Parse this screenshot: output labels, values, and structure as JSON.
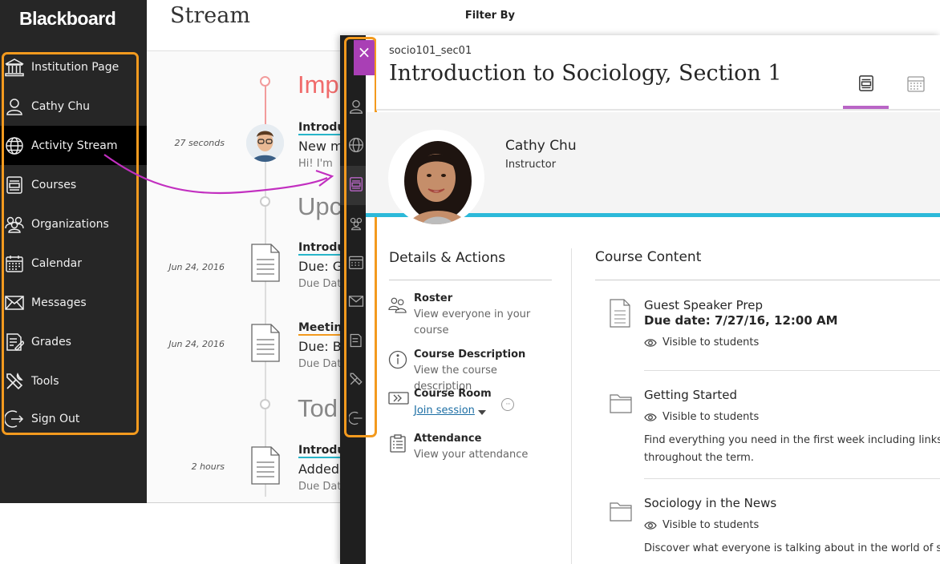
{
  "nav": {
    "brand": "Blackboard",
    "items": [
      {
        "label": "Institution Page",
        "icon": "institution-icon"
      },
      {
        "label": "Cathy Chu",
        "icon": "user-icon"
      },
      {
        "label": "Activity Stream",
        "icon": "globe-icon"
      },
      {
        "label": "Courses",
        "icon": "courses-icon"
      },
      {
        "label": "Organizations",
        "icon": "organizations-icon"
      },
      {
        "label": "Calendar",
        "icon": "calendar-icon"
      },
      {
        "label": "Messages",
        "icon": "messages-icon"
      },
      {
        "label": "Grades",
        "icon": "grades-icon"
      },
      {
        "label": "Tools",
        "icon": "tools-icon"
      },
      {
        "label": "Sign Out",
        "icon": "sign-out-icon"
      }
    ]
  },
  "stream": {
    "title": "Stream",
    "filter_label": "Filter By",
    "sections": [
      "Imp",
      "Upc",
      "Tod"
    ],
    "items": [
      {
        "time": "27 seconds",
        "title": "Introdu",
        "main": "New m",
        "sub": "Hi! I'm"
      },
      {
        "time": "Jun 24, 2016",
        "title": "Introdu",
        "main": "Due: Gu",
        "sub": "Due Dat"
      },
      {
        "time": "Jun 24, 2016",
        "title": "Meeting",
        "main": "Due: Br",
        "sub": "Due Dat"
      },
      {
        "time": "2 hours",
        "title": "Introdu",
        "main": "Added:",
        "sub": "Due Dat"
      }
    ]
  },
  "course": {
    "close_label": "×",
    "course_id": "socio101_sec01",
    "title": "Introduction to Sociology, Section 1",
    "instructor": {
      "name": "Cathy Chu",
      "role": "Instructor"
    },
    "details": {
      "title": "Details & Actions",
      "roster": {
        "title": "Roster",
        "sub": "View everyone in your course"
      },
      "description": {
        "title": "Course Description",
        "sub": "View the course description"
      },
      "room": {
        "title": "Course Room",
        "link": "Join session",
        "more": "···"
      },
      "attendance": {
        "title": "Attendance",
        "sub": "View your attendance"
      }
    },
    "content": {
      "title": "Course Content",
      "items": [
        {
          "title": "Guest Speaker Prep",
          "due": "Due date: 7/27/16, 12:00 AM",
          "visibility": "Visible to students",
          "desc": ""
        },
        {
          "title": "Getting Started",
          "due": "",
          "visibility": "Visible to students",
          "desc1": "Find everything you need in the first week including links to",
          "desc2": "throughout the term."
        },
        {
          "title": "Sociology in the News",
          "due": "",
          "visibility": "Visible to students",
          "desc1": "Discover what everyone is talking about in the world of socio"
        }
      ]
    }
  },
  "colors": {
    "accent_purple": "#a93fb5",
    "highlight_orange": "#f39a1e",
    "banner_blue": "#2cb9d9"
  }
}
